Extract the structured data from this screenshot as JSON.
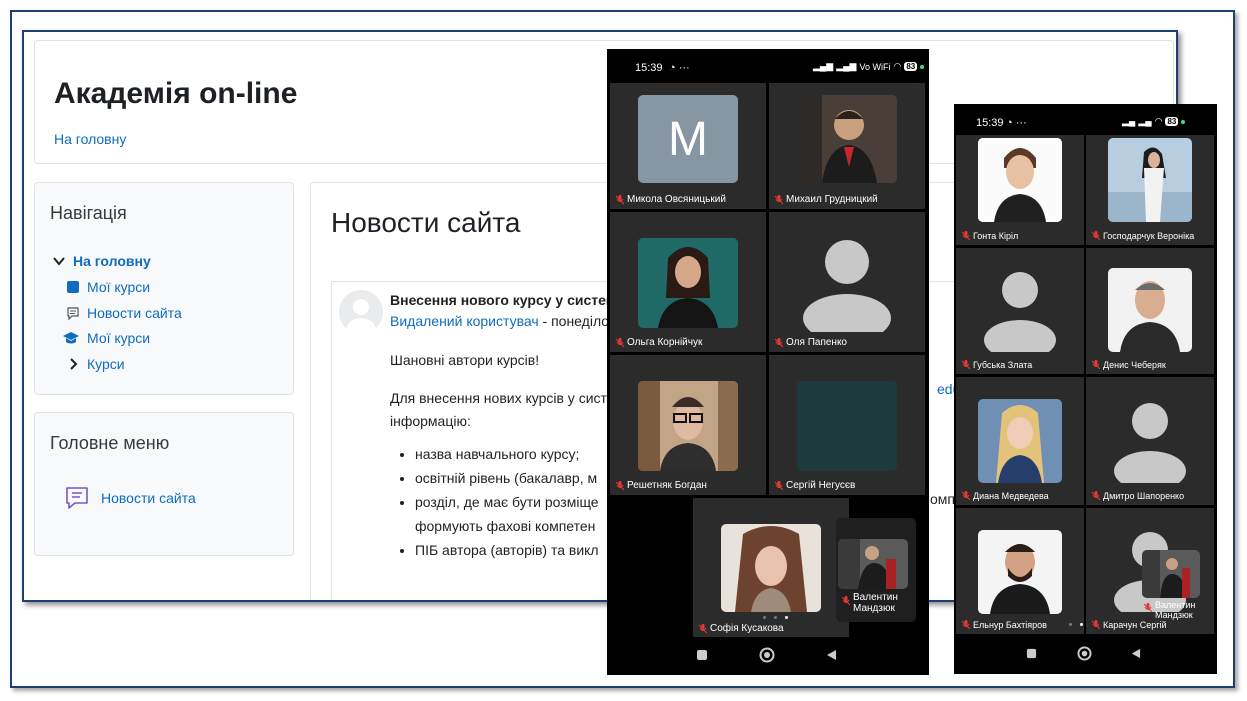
{
  "moodle": {
    "site_title": "Академія on-line",
    "home_link": "На головну",
    "navigation": {
      "heading": "Навігація",
      "items": [
        {
          "label": "На головну"
        },
        {
          "label": "Мої курси"
        },
        {
          "label": "Новости сайта"
        },
        {
          "label": "Мої курси"
        },
        {
          "label": "Курси"
        }
      ]
    },
    "main_menu": {
      "heading": "Головне меню",
      "item": "Новости сайта"
    },
    "page_title": "Новости сайта",
    "post": {
      "subject": "Внесення нового курсу у систем",
      "author": "Видалений користувач",
      "date_fragment": " - понеділо",
      "greeting": "Шановні автори курсів!",
      "paragraph_line1": "Для внесення нових курсів у сист",
      "paragraph_line1_tail": "edu",
      "paragraph_line2": "інформацію:",
      "bullets": [
        "назва навчального курсу;",
        "освітній рівень (бакалавр, м",
        "розділ, де має бути розміще",
        "ПІБ автора (авторів) та викл"
      ],
      "bullet3_continuation": "формують фахові компетен",
      "bullet3_tail": "омпе"
    }
  },
  "phone1": {
    "time": "15:39",
    "status_extra": "···",
    "signal": "Vo WiFi",
    "battery": "83",
    "tiles": [
      {
        "name": "Микола Овсяницький",
        "avatar_letter": "M"
      },
      {
        "name": "Михаил Грудницкий"
      },
      {
        "name": "Ольга Корнійчук"
      },
      {
        "name": "Оля Папенко"
      },
      {
        "name": "Решетняк Богдан"
      },
      {
        "name": "Сергій Негусєв"
      }
    ],
    "featured": {
      "name": "Софія Кусакова"
    },
    "pip": {
      "name_line1": "Валентин",
      "name_line2": "Мандзюк"
    }
  },
  "phone2": {
    "time": "15:39",
    "status_extra": "···",
    "battery": "83",
    "tiles": [
      {
        "name": "Гонта Кіріл"
      },
      {
        "name": "Господарчук Вероніка"
      },
      {
        "name": "Губська Злата"
      },
      {
        "name": "Денис Чеберяк"
      },
      {
        "name": "Диана Медведева"
      },
      {
        "name": "Дмитро Шапоренко"
      },
      {
        "name": "Ельнур Бахтіяров"
      },
      {
        "name": "Карачун Сергій"
      }
    ],
    "pip": {
      "name_line1": "Валентин",
      "name_line2": "Мандзюк"
    }
  },
  "colors": {
    "link": "#0f6cbf",
    "frame": "#1f3f73",
    "tile_bg": "#2b2b2b",
    "avatar_grey": "#c8c8c8"
  }
}
